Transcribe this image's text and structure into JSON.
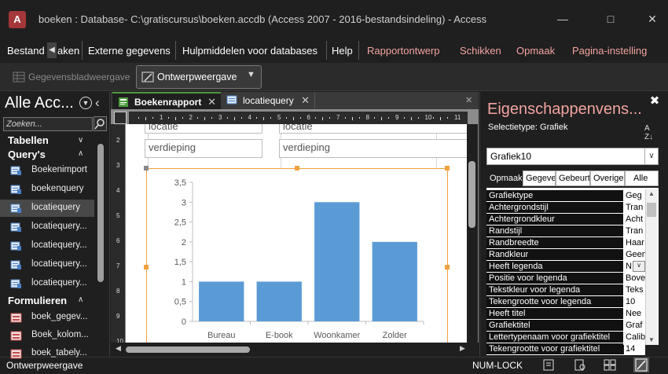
{
  "window": {
    "title": "boeken : Database- C:\\gratiscursus\\boeken.accdb (Access 2007 - 2016-bestandsindeling)  -  Access",
    "app_icon": "A"
  },
  "ribbon": {
    "tabs": [
      {
        "label": "Bestand"
      },
      {
        "label": "aken"
      },
      {
        "label": "Externe gegevens"
      },
      {
        "label": "Hulpmiddelen voor databases"
      },
      {
        "label": "Help"
      }
    ],
    "context_tabs": [
      {
        "label": "Rapportontwerp"
      },
      {
        "label": "Schikken"
      },
      {
        "label": "Opmaak"
      },
      {
        "label": "Pagina-instelling"
      }
    ],
    "datasheet_view": "Gegevensbladweergave",
    "design_view": "Ontwerpweergave"
  },
  "nav": {
    "title": "Alle Acc...",
    "search_placeholder": "Zoeken...",
    "groups": {
      "tables": "Tabellen",
      "queries": "Query's",
      "forms": "Formulieren"
    },
    "queries": [
      "Boekenimport",
      "boekenquery",
      "locatiequery",
      "locatiequery...",
      "locatiequery...",
      "locatiequery...",
      "locatiequery..."
    ],
    "forms": [
      "boek_gegev...",
      "Boek_kolom...",
      "boek_tabely..."
    ]
  },
  "doc": {
    "tabs": [
      {
        "label": "Boekenrapport"
      },
      {
        "label": "locatiequery"
      }
    ],
    "fields": {
      "label_top": "locatie",
      "text_top": "locatie",
      "label": "verdieping",
      "text": "verdieping"
    },
    "ruler_top": [
      "1",
      "2",
      "3",
      "4",
      "5",
      "6",
      "7",
      "8",
      "9",
      "10",
      "11"
    ],
    "ruler_left": [
      "2",
      "3",
      "4",
      "5",
      "6",
      "7",
      "8",
      "9",
      "10"
    ]
  },
  "chart_data": {
    "type": "bar",
    "categories": [
      "Bureau",
      "E-book",
      "Woonkamer",
      "Zolder"
    ],
    "values": [
      1,
      1,
      3,
      2
    ],
    "ylim": [
      0,
      3.5
    ],
    "yticks": [
      "0",
      "0,5",
      "1",
      "1,5",
      "2",
      "2,5",
      "3",
      "3,5"
    ],
    "bar_color": "#5b9bd5",
    "grid": false
  },
  "props": {
    "title": "Eigenschappenvens...",
    "selection_type": "Selectietype:  Grafiek",
    "selected_object": "Grafiek10",
    "tabs": [
      "Opmaak",
      "Gegever",
      "Gebeurt",
      "Overige",
      "Alle"
    ],
    "rows": [
      {
        "name": "Grafiektype",
        "value": "Geg"
      },
      {
        "name": "Achtergrondstijl",
        "value": "Tran"
      },
      {
        "name": "Achtergrondkleur",
        "value": "Acht"
      },
      {
        "name": "Randstijl",
        "value": "Tran"
      },
      {
        "name": "Randbreedte",
        "value": "Haar"
      },
      {
        "name": "Randkleur",
        "value": "Geen"
      },
      {
        "name": "Heeft legenda",
        "value": "N"
      },
      {
        "name": "Positie voor legenda",
        "value": "Bove"
      },
      {
        "name": "Tekstkleur voor legenda",
        "value": "Teks"
      },
      {
        "name": "Tekengrootte voor legenda",
        "value": "10"
      },
      {
        "name": "Heeft titel",
        "value": "Nee"
      },
      {
        "name": "Grafiektitel",
        "value": "Graf"
      },
      {
        "name": "Lettertypenaam voor grafiektitel",
        "value": "Calib"
      },
      {
        "name": "Tekengrootte voor grafiektitel",
        "value": "14"
      }
    ]
  },
  "status": {
    "view": "Ontwerpweergave",
    "numlock": "NUM-LOCK"
  },
  "colors": {
    "context_tab": "#f2a3a0",
    "selection_border": "#f0a040",
    "report_tab_accent": "#4e9a3e"
  }
}
